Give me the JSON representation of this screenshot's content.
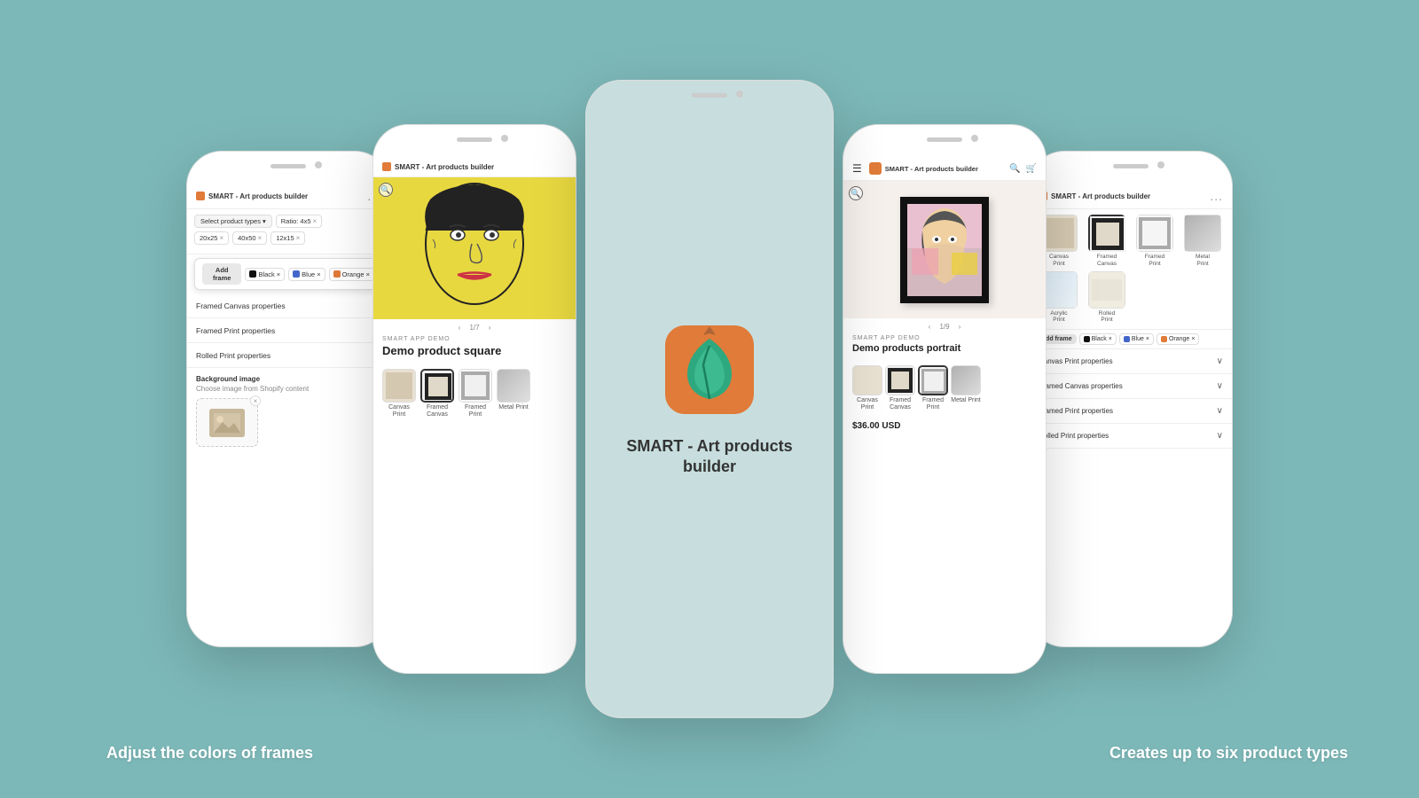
{
  "background": "#7db8b8",
  "phones": {
    "phone1": {
      "admin_bar": {
        "icon_label": "SMART - Art products builder",
        "dots": "..."
      },
      "filters": {
        "select_placeholder": "Select product types",
        "tags": [
          "Ratio: 4x5",
          "20x25",
          "40x50",
          "12x15"
        ],
        "frame_btn": "Add frame",
        "colors": [
          "Black",
          "Blue",
          "Orange"
        ]
      },
      "properties": [
        {
          "label": "Framed Canvas properties",
          "expanded": false
        },
        {
          "label": "Framed Print properties",
          "expanded": false
        },
        {
          "label": "Rolled Print properties",
          "expanded": false
        }
      ],
      "background_section": {
        "title": "Background image",
        "subtitle": "Choose image from Shopify content"
      }
    },
    "phone2": {
      "demo_label": "SMART APP DEMO",
      "product_title": "Demo product square",
      "nav": "1/7",
      "types": [
        {
          "label": "Canvas Print",
          "selected": false
        },
        {
          "label": "Framed Canvas",
          "selected": true
        },
        {
          "label": "Framed Print",
          "selected": false
        },
        {
          "label": "Metal Print",
          "selected": false
        }
      ]
    },
    "phone_center": {
      "logo_alt": "SMART leaf logo",
      "title": "SMART - Art products builder"
    },
    "phone4": {
      "shop_name": "SMART - Art products builder",
      "demo_label": "SMART APP DEMO",
      "product_title": "Demo products portrait",
      "nav": "1/9",
      "price": "$36.00 USD",
      "types": [
        {
          "label": "Canvas Print",
          "selected": false
        },
        {
          "label": "Framed Canvas",
          "selected": false
        },
        {
          "label": "Framed Print",
          "selected": true
        },
        {
          "label": "Metal Print",
          "selected": false
        }
      ]
    },
    "phone5": {
      "admin_bar": {
        "label": "SMART - Art products builder",
        "dots": "..."
      },
      "types": [
        {
          "label": "Canvas Print",
          "selected": false
        },
        {
          "label": "Framed Canvas",
          "selected": true
        },
        {
          "label": "Framed Print",
          "selected": false
        },
        {
          "label": "Metal Print",
          "selected": false
        },
        {
          "label": "Acrylic Print",
          "selected": false
        },
        {
          "label": "Rolled Print",
          "selected": false
        }
      ],
      "colors": [
        "Black",
        "Blue",
        "Orange"
      ],
      "properties": [
        {
          "label": "Canvas Print properties"
        },
        {
          "label": "Framed Canvas properties"
        },
        {
          "label": "Framed Print properties"
        },
        {
          "label": "Rolled Print properties"
        }
      ]
    }
  },
  "captions": {
    "left": "Adjust the colors of  frames",
    "right": "Creates up to six product types"
  },
  "colors": {
    "black": "#111111",
    "blue": "#4466cc",
    "orange": "#e07b39",
    "accent": "#e07b39"
  }
}
